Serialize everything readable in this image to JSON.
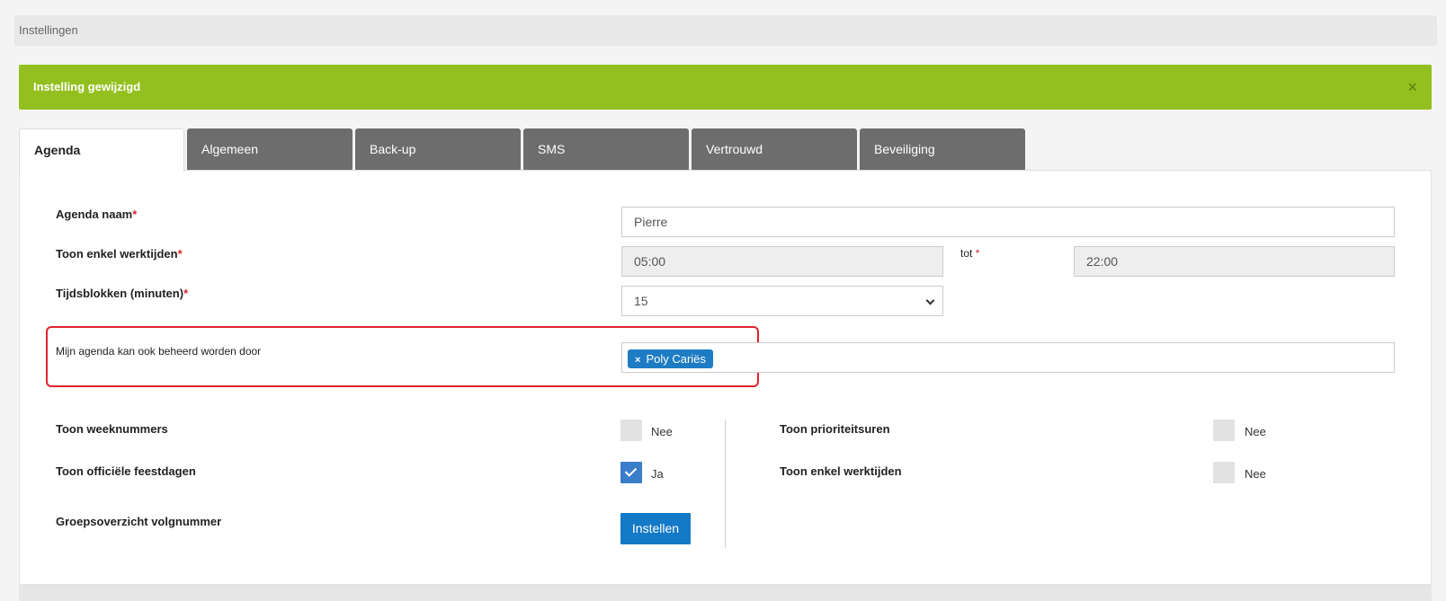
{
  "breadcrumb": {
    "label": "Instellingen"
  },
  "alert": {
    "message": "Instelling gewijzigd",
    "close": "×"
  },
  "tabs": [
    {
      "label": "Agenda"
    },
    {
      "label": "Algemeen"
    },
    {
      "label": "Back-up"
    },
    {
      "label": "SMS"
    },
    {
      "label": "Vertrouwd"
    },
    {
      "label": "Beveiliging"
    }
  ],
  "form": {
    "agenda_naam": {
      "label": "Agenda naam",
      "required": "*",
      "value": "Pierre"
    },
    "werktijden": {
      "label": "Toon enkel werktijden",
      "required": "*",
      "from": "05:00",
      "to_label": "tot",
      "to_required": "*",
      "to": "22:00"
    },
    "tijdsblokken": {
      "label": "Tijdsblokken (minuten)",
      "required": "*",
      "value": "15"
    },
    "beheerd": {
      "label": "Mijn agenda kan ook beheerd worden door",
      "tag_remove": "×",
      "tag": "Poly Cariës"
    },
    "weeknummers": {
      "label": "Toon weeknummers",
      "value": "Nee"
    },
    "feestdagen": {
      "label": "Toon officiële feestdagen",
      "value": "Ja"
    },
    "volgnummer": {
      "label": "Groepsoverzicht volgnummer",
      "button": "Instellen"
    },
    "prioriteitsuren": {
      "label": "Toon prioriteitsuren",
      "value": "Nee"
    },
    "enkel_werktijden": {
      "label": "Toon enkel werktijden",
      "value": "Nee"
    }
  }
}
